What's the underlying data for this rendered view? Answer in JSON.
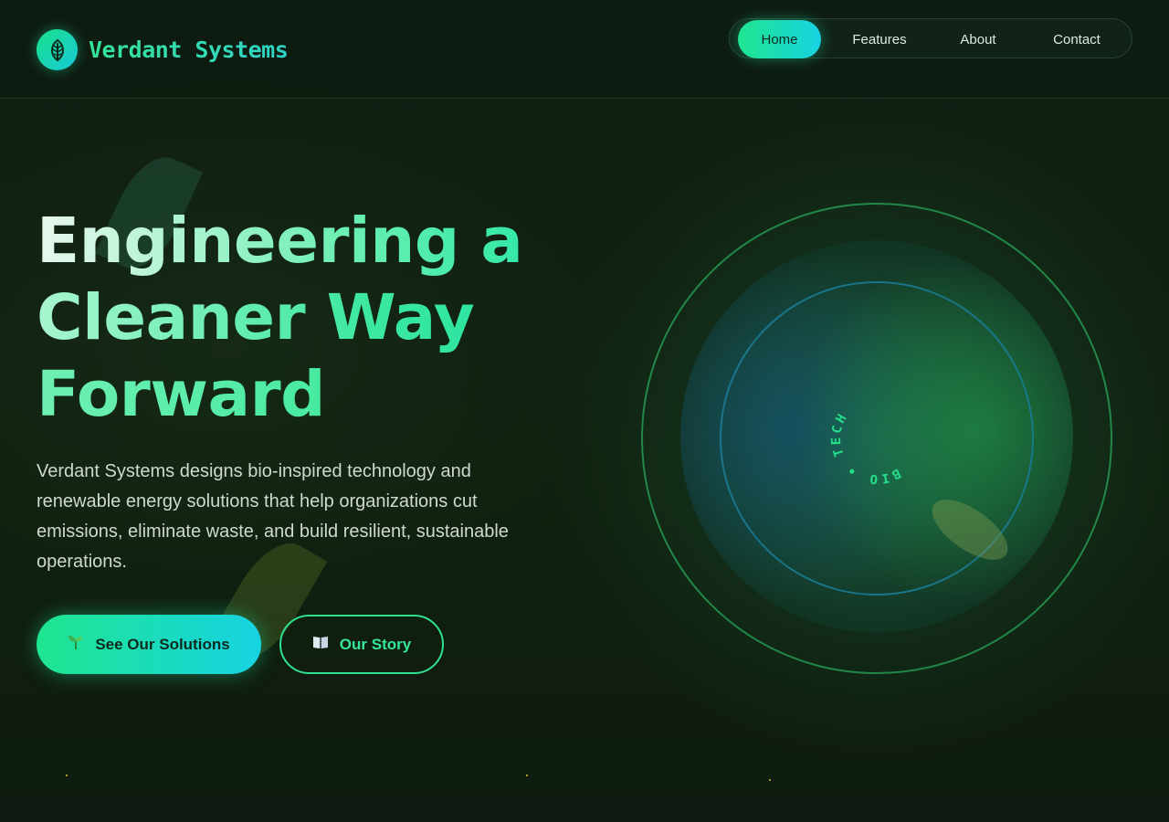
{
  "brand": {
    "name": "Verdant Systems",
    "logo_icon": "leaf-icon"
  },
  "nav": {
    "items": [
      {
        "label": "Home",
        "active": true
      },
      {
        "label": "Features",
        "active": false
      },
      {
        "label": "About",
        "active": false
      },
      {
        "label": "Contact",
        "active": false
      }
    ]
  },
  "hero": {
    "headline": [
      "Engineering a",
      "Cleaner Way",
      "Forward"
    ],
    "lead": "Verdant Systems designs bio-inspired technology and renewable energy solutions that help organizations cut emissions, eliminate waste, and build resilient, sustainable operations.",
    "primary_button": {
      "label": "See Our Solutions",
      "icon": "sprout-icon"
    },
    "secondary_button": {
      "label": "Our Story",
      "icon": "book-icon"
    }
  },
  "visual": {
    "ring_text": "BIO • TECH"
  },
  "colors": {
    "accent_green": "#1fe58e",
    "accent_cyan": "#17d3e3",
    "background": "#0f1c12"
  }
}
